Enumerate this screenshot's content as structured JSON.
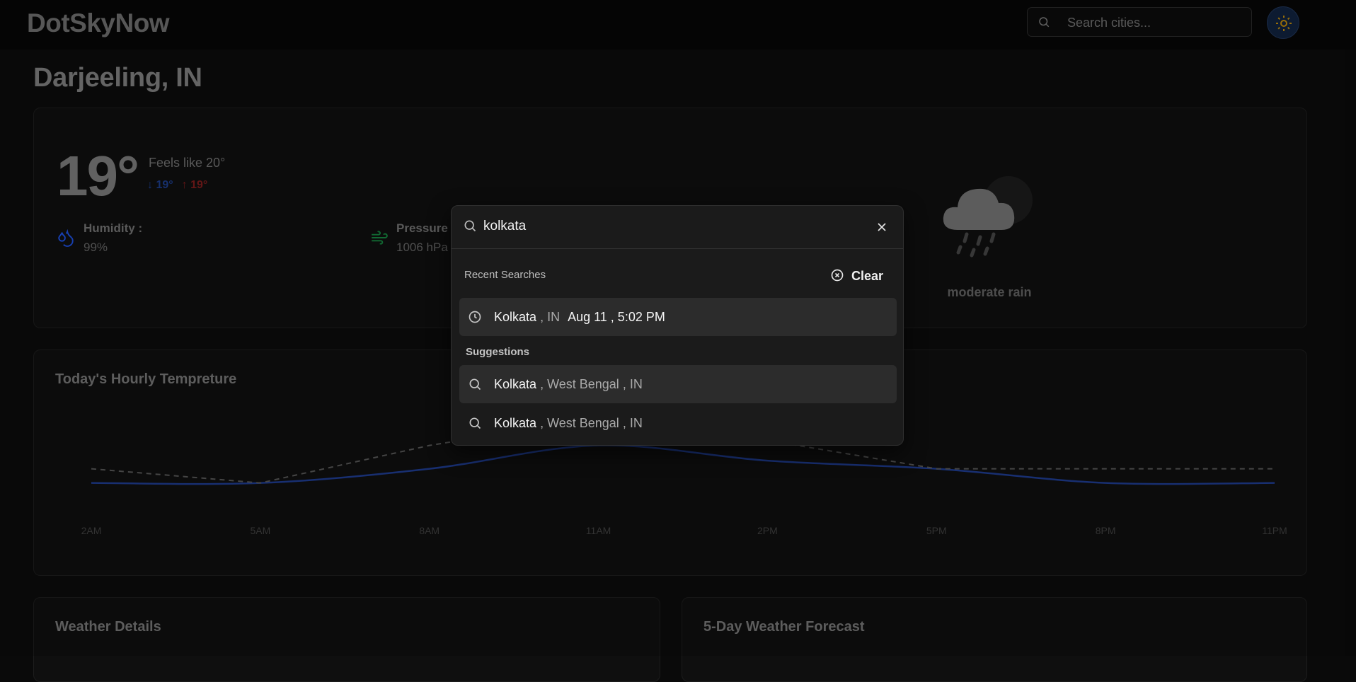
{
  "header": {
    "brand": "DotSkyNow",
    "search_placeholder": "Search cities...",
    "theme_toggle_icon": "sun-icon"
  },
  "location": {
    "name": "Darjeeling, IN"
  },
  "current": {
    "temp": "19°",
    "feels_like": "Feels like 20°",
    "min": "19°",
    "max": "19°",
    "humidity_label": "Humidity :",
    "humidity_value": "99%",
    "pressure_label": "Pressure :",
    "pressure_value": "1006 hPa",
    "condition": "moderate rain",
    "condition_icon": "cloud-rain-moon-icon"
  },
  "hourly": {
    "title": "Today's Hourly Tempreture",
    "chart_data": {
      "type": "line",
      "categories": [
        "2AM",
        "5AM",
        "8AM",
        "11AM",
        "2PM",
        "5PM",
        "8PM",
        "11PM"
      ],
      "series": [
        {
          "values": [
            19,
            19,
            20.4,
            22.7,
            21.2,
            20.4,
            19,
            19
          ],
          "color": "#1e3a8a"
        },
        {
          "values": [
            20.4,
            19,
            22.7,
            25.4,
            23.2,
            20.4,
            20.4,
            20.4
          ],
          "color": "#555555",
          "dashed": true
        }
      ],
      "ylim": [
        18,
        30
      ]
    }
  },
  "sections": {
    "details_title": "Weather Details",
    "forecast_title": "5-Day Weather Forecast"
  },
  "search_dropdown": {
    "query": "kolkata",
    "recent_label": "Recent Searches",
    "clear_label": "Clear",
    "recent": [
      {
        "name": "Kolkata",
        "region": ", IN",
        "when": "Aug 11 , 5:02 PM"
      }
    ],
    "suggestions_label": "Suggestions",
    "suggestions": [
      {
        "name": "Kolkata",
        "state": ", West Bengal",
        "country": ", IN"
      },
      {
        "name": "Kolkata",
        "state": ", West Bengal",
        "country": ", IN"
      }
    ]
  },
  "colors": {
    "background": "#0a0a0a",
    "min_temp": "#1c3b86",
    "max_temp": "#7a1c1c",
    "humidity_icon": "#1d4ed8",
    "pressure_icon": "#15803d",
    "sun_icon": "#b8860b"
  }
}
